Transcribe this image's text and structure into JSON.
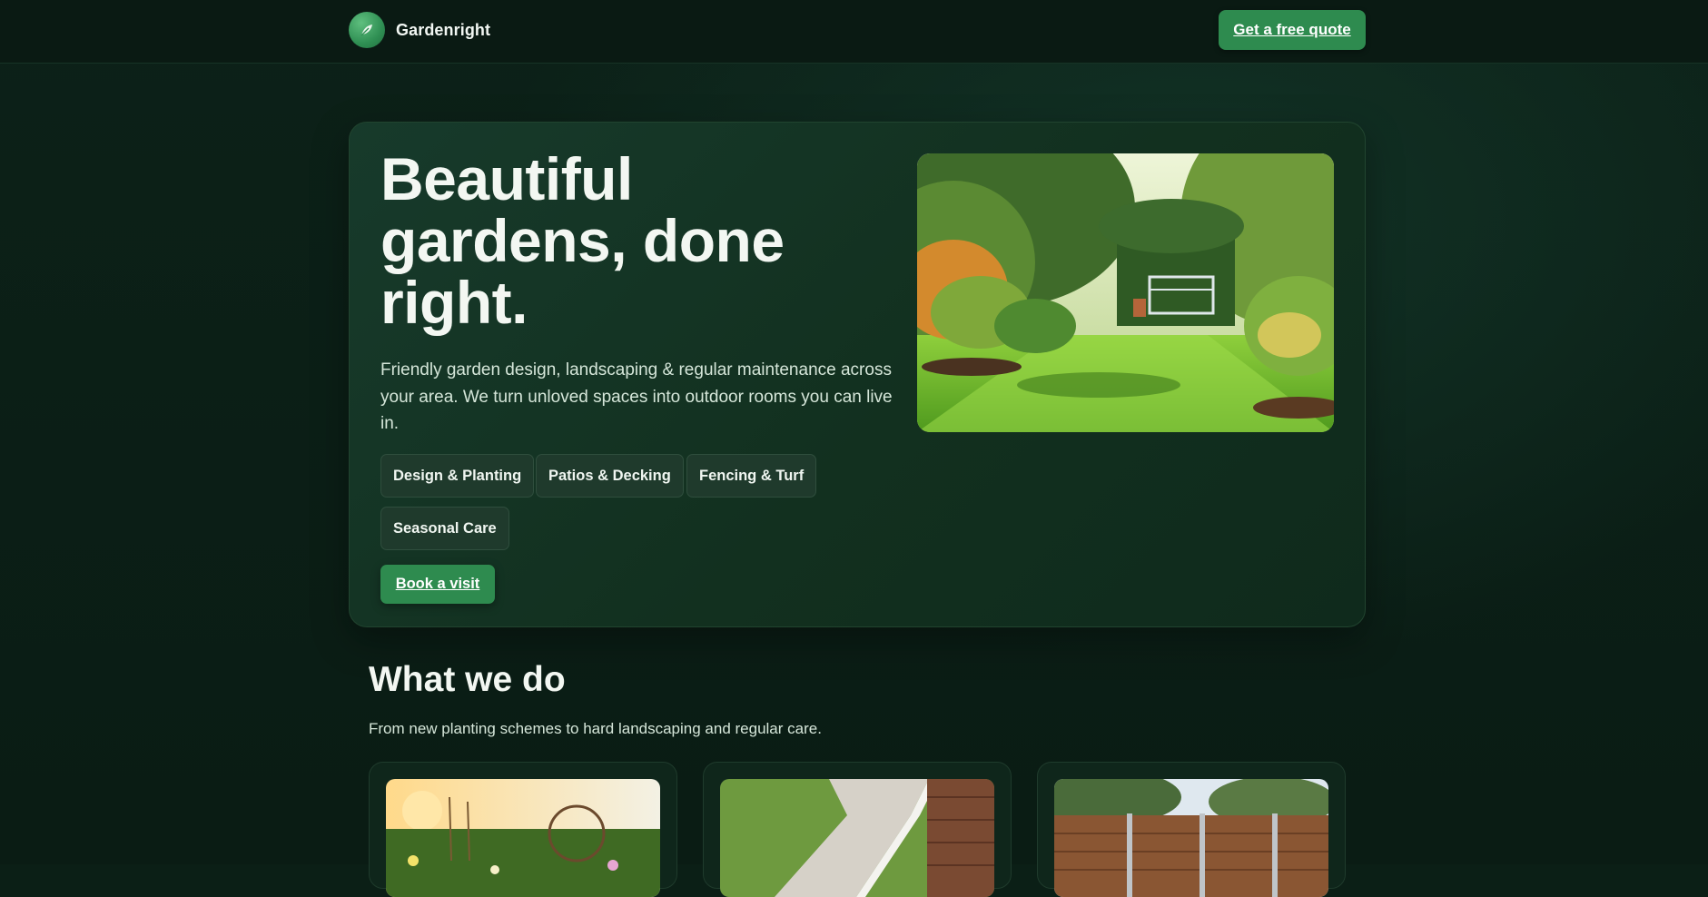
{
  "header": {
    "brand_name": "Gardenright",
    "logo_icon": "leaf-icon",
    "cta_label": "Get a free quote"
  },
  "hero": {
    "title_line1": "Beautiful",
    "title_line2": "gardens, done",
    "title_line3": "right.",
    "description": "Friendly garden design, landscaping & regular maintenance across your area. We turn unloved spaces into outdoor rooms you can live in.",
    "chips": [
      "Design & Planting",
      "Patios & Decking",
      "Fencing & Turf",
      "Seasonal Care"
    ],
    "book_label": "Book a visit"
  },
  "services": {
    "title": "What we do",
    "subtitle": "From new planting schemes to hard landscaping and regular care."
  },
  "colors": {
    "background": "#0b1f16",
    "accent": "#2e8b4f",
    "card": "#173a2b"
  }
}
